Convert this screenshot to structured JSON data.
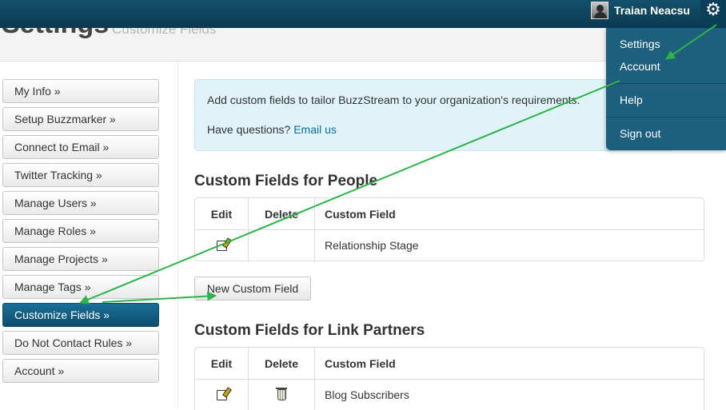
{
  "header": {
    "user_name": "Traian Neacsu",
    "page_title": "Settings",
    "page_subtitle": "Customize Fields"
  },
  "user_menu": {
    "items": [
      "Settings",
      "Account",
      "Help",
      "Sign out"
    ]
  },
  "sidebar": {
    "items": [
      {
        "label": "My Info »"
      },
      {
        "label": "Setup Buzzmarker »"
      },
      {
        "label": "Connect to Email »"
      },
      {
        "label": "Twitter Tracking »"
      },
      {
        "label": "Manage Users »"
      },
      {
        "label": "Manage Roles »"
      },
      {
        "label": "Manage Projects »"
      },
      {
        "label": "Manage Tags »"
      },
      {
        "label": "Customize Fields »",
        "active": true
      },
      {
        "label": "Do Not Contact Rules »"
      },
      {
        "label": "Account »"
      }
    ]
  },
  "info_box": {
    "text": "Add custom fields to tailor BuzzStream to your organization's requirements.",
    "question": "Have questions?",
    "link": "Email us"
  },
  "people_section": {
    "title": "Custom Fields for People",
    "headers": [
      "Edit",
      "Delete",
      "Custom Field"
    ],
    "rows": [
      {
        "field": "Relationship Stage",
        "deletable": false
      }
    ],
    "new_button": "New Custom Field"
  },
  "partners_section": {
    "title": "Custom Fields for Link Partners",
    "headers": [
      "Edit",
      "Delete",
      "Custom Field"
    ],
    "rows": [
      {
        "field": "Blog Subscribers",
        "deletable": true
      }
    ]
  },
  "annotation": {
    "arrow_color": "#2db34a"
  }
}
